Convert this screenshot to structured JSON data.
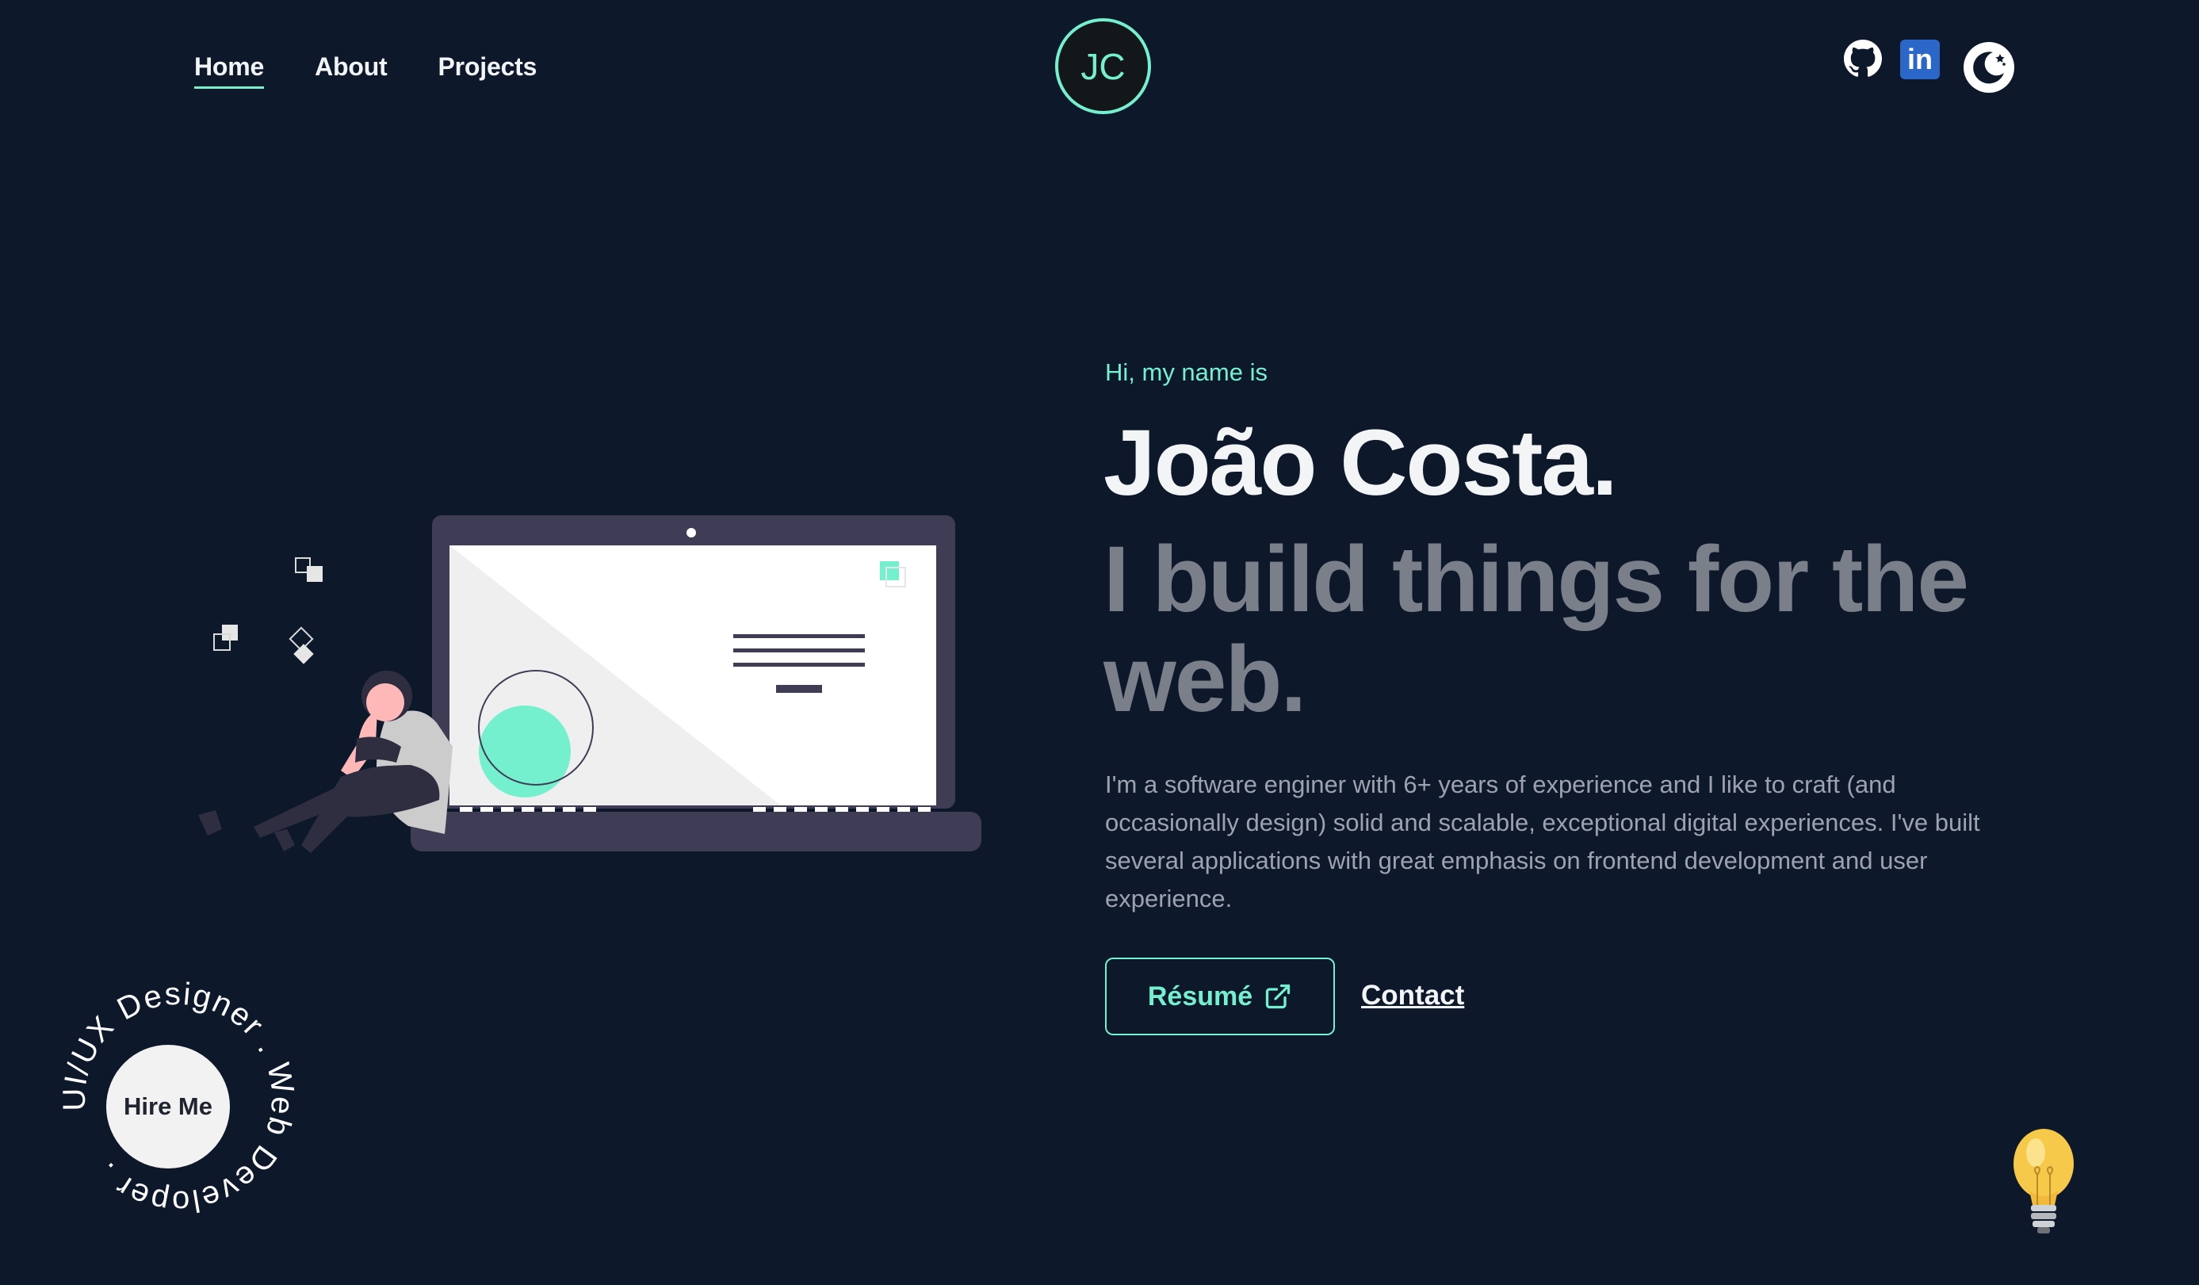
{
  "header": {
    "nav": [
      {
        "label": "Home",
        "active": true
      },
      {
        "label": "About",
        "active": false
      },
      {
        "label": "Projects",
        "active": false
      }
    ],
    "logo_text": "JC",
    "social": [
      "github-icon",
      "linkedin-icon",
      "moon-icon"
    ],
    "linkedin_text": "in"
  },
  "hero": {
    "greeting": "Hi, my name is",
    "name": "João Costa.",
    "tagline": "I build things for the web.",
    "description": "I'm a software enginer with 6+ years of experience and I like to craft (and occasionally design) solid and scalable, exceptional digital experiences. I've built several applications with great emphasis on frontend development and user experience.",
    "resume_label": "Résumé",
    "contact_label": "Contact"
  },
  "hire": {
    "ring_text": "UI/UX Designer . Web Developer . ",
    "button_label": "Hire Me"
  },
  "colors": {
    "background": "#0d182b",
    "accent": "#74f0cf",
    "muted": "#7a7f89",
    "text": "#f3f4f6"
  }
}
